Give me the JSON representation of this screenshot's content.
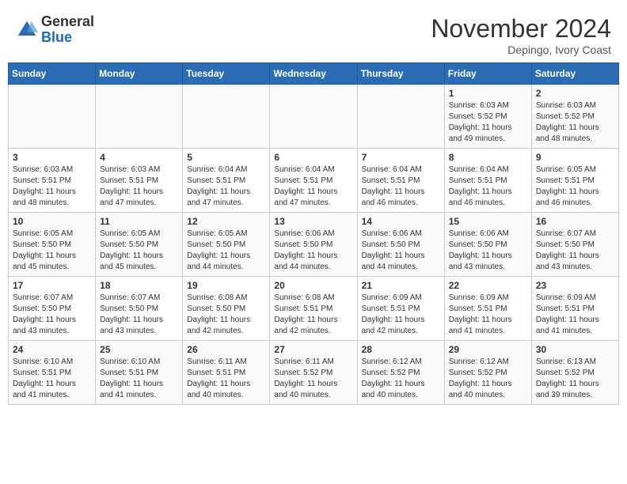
{
  "header": {
    "logo_general": "General",
    "logo_blue": "Blue",
    "month_title": "November 2024",
    "location": "Depingo, Ivory Coast"
  },
  "weekdays": [
    "Sunday",
    "Monday",
    "Tuesday",
    "Wednesday",
    "Thursday",
    "Friday",
    "Saturday"
  ],
  "weeks": [
    [
      {
        "day": "",
        "info": ""
      },
      {
        "day": "",
        "info": ""
      },
      {
        "day": "",
        "info": ""
      },
      {
        "day": "",
        "info": ""
      },
      {
        "day": "",
        "info": ""
      },
      {
        "day": "1",
        "info": "Sunrise: 6:03 AM\nSunset: 5:52 PM\nDaylight: 11 hours and 49 minutes."
      },
      {
        "day": "2",
        "info": "Sunrise: 6:03 AM\nSunset: 5:52 PM\nDaylight: 11 hours and 48 minutes."
      }
    ],
    [
      {
        "day": "3",
        "info": "Sunrise: 6:03 AM\nSunset: 5:51 PM\nDaylight: 11 hours and 48 minutes."
      },
      {
        "day": "4",
        "info": "Sunrise: 6:03 AM\nSunset: 5:51 PM\nDaylight: 11 hours and 47 minutes."
      },
      {
        "day": "5",
        "info": "Sunrise: 6:04 AM\nSunset: 5:51 PM\nDaylight: 11 hours and 47 minutes."
      },
      {
        "day": "6",
        "info": "Sunrise: 6:04 AM\nSunset: 5:51 PM\nDaylight: 11 hours and 47 minutes."
      },
      {
        "day": "7",
        "info": "Sunrise: 6:04 AM\nSunset: 5:51 PM\nDaylight: 11 hours and 46 minutes."
      },
      {
        "day": "8",
        "info": "Sunrise: 6:04 AM\nSunset: 5:51 PM\nDaylight: 11 hours and 46 minutes."
      },
      {
        "day": "9",
        "info": "Sunrise: 6:05 AM\nSunset: 5:51 PM\nDaylight: 11 hours and 46 minutes."
      }
    ],
    [
      {
        "day": "10",
        "info": "Sunrise: 6:05 AM\nSunset: 5:50 PM\nDaylight: 11 hours and 45 minutes."
      },
      {
        "day": "11",
        "info": "Sunrise: 6:05 AM\nSunset: 5:50 PM\nDaylight: 11 hours and 45 minutes."
      },
      {
        "day": "12",
        "info": "Sunrise: 6:05 AM\nSunset: 5:50 PM\nDaylight: 11 hours and 44 minutes."
      },
      {
        "day": "13",
        "info": "Sunrise: 6:06 AM\nSunset: 5:50 PM\nDaylight: 11 hours and 44 minutes."
      },
      {
        "day": "14",
        "info": "Sunrise: 6:06 AM\nSunset: 5:50 PM\nDaylight: 11 hours and 44 minutes."
      },
      {
        "day": "15",
        "info": "Sunrise: 6:06 AM\nSunset: 5:50 PM\nDaylight: 11 hours and 43 minutes."
      },
      {
        "day": "16",
        "info": "Sunrise: 6:07 AM\nSunset: 5:50 PM\nDaylight: 11 hours and 43 minutes."
      }
    ],
    [
      {
        "day": "17",
        "info": "Sunrise: 6:07 AM\nSunset: 5:50 PM\nDaylight: 11 hours and 43 minutes."
      },
      {
        "day": "18",
        "info": "Sunrise: 6:07 AM\nSunset: 5:50 PM\nDaylight: 11 hours and 43 minutes."
      },
      {
        "day": "19",
        "info": "Sunrise: 6:08 AM\nSunset: 5:50 PM\nDaylight: 11 hours and 42 minutes."
      },
      {
        "day": "20",
        "info": "Sunrise: 6:08 AM\nSunset: 5:51 PM\nDaylight: 11 hours and 42 minutes."
      },
      {
        "day": "21",
        "info": "Sunrise: 6:09 AM\nSunset: 5:51 PM\nDaylight: 11 hours and 42 minutes."
      },
      {
        "day": "22",
        "info": "Sunrise: 6:09 AM\nSunset: 5:51 PM\nDaylight: 11 hours and 41 minutes."
      },
      {
        "day": "23",
        "info": "Sunrise: 6:09 AM\nSunset: 5:51 PM\nDaylight: 11 hours and 41 minutes."
      }
    ],
    [
      {
        "day": "24",
        "info": "Sunrise: 6:10 AM\nSunset: 5:51 PM\nDaylight: 11 hours and 41 minutes."
      },
      {
        "day": "25",
        "info": "Sunrise: 6:10 AM\nSunset: 5:51 PM\nDaylight: 11 hours and 41 minutes."
      },
      {
        "day": "26",
        "info": "Sunrise: 6:11 AM\nSunset: 5:51 PM\nDaylight: 11 hours and 40 minutes."
      },
      {
        "day": "27",
        "info": "Sunrise: 6:11 AM\nSunset: 5:52 PM\nDaylight: 11 hours and 40 minutes."
      },
      {
        "day": "28",
        "info": "Sunrise: 6:12 AM\nSunset: 5:52 PM\nDaylight: 11 hours and 40 minutes."
      },
      {
        "day": "29",
        "info": "Sunrise: 6:12 AM\nSunset: 5:52 PM\nDaylight: 11 hours and 40 minutes."
      },
      {
        "day": "30",
        "info": "Sunrise: 6:13 AM\nSunset: 5:52 PM\nDaylight: 11 hours and 39 minutes."
      }
    ]
  ]
}
